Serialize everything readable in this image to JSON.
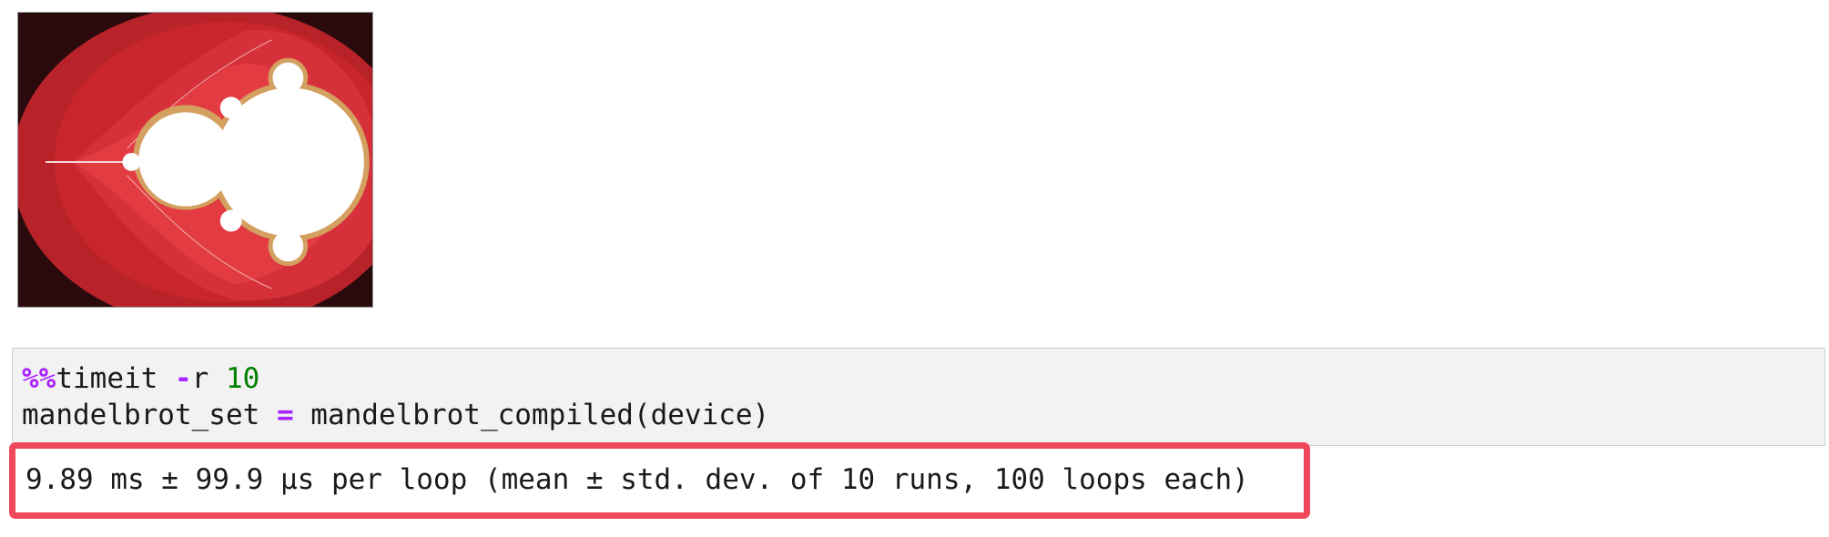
{
  "image_output": {
    "icon": "mandelbrot-image",
    "colors": {
      "background": "#2a0a0c",
      "outer": "#c8262c",
      "inner": "#e0383c",
      "set": "#ffffff"
    }
  },
  "code_cell": {
    "line1": {
      "magic": "%%",
      "command": "timeit ",
      "flag_op": "-",
      "flag": "r ",
      "number": "10"
    },
    "line2": {
      "target": "mandelbrot_set ",
      "assign": "=",
      "call": " mandelbrot_compiled(device)"
    }
  },
  "stdout": {
    "text": "9.89 ms ± 99.9 µs per loop (mean ± std. dev. of 10 runs, 100 loops each)",
    "highlight_color": "#f0485a"
  }
}
